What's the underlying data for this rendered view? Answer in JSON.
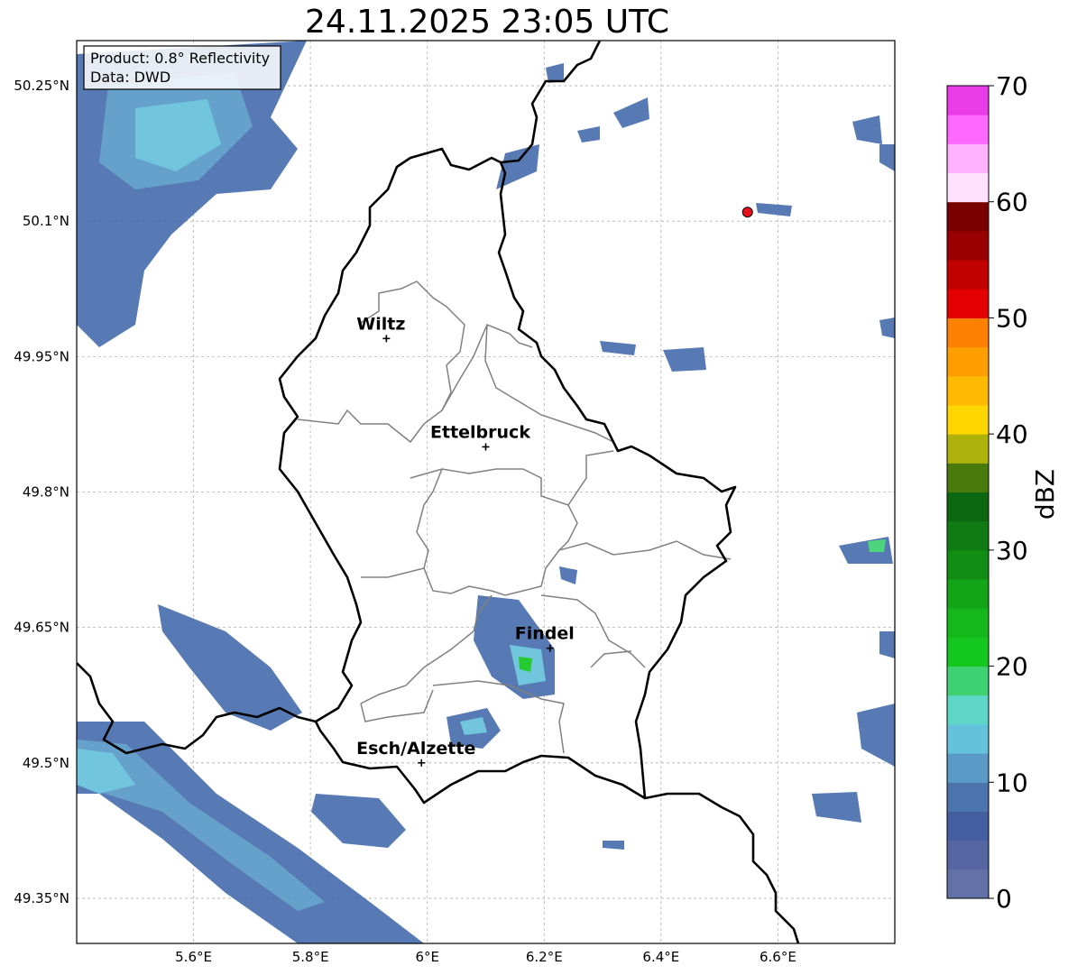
{
  "title": "24.11.2025 23:05 UTC",
  "info_box": {
    "product": "Product: 0.8° Reflectivity",
    "data_source": "Data: DWD"
  },
  "map": {
    "lon_range": [
      5.4,
      6.8
    ],
    "lat_range": [
      49.3,
      50.3
    ],
    "x_ticks": [
      {
        "value": 5.6,
        "label": "5.6°E"
      },
      {
        "value": 5.8,
        "label": "5.8°E"
      },
      {
        "value": 6.0,
        "label": "6°E"
      },
      {
        "value": 6.2,
        "label": "6.2°E"
      },
      {
        "value": 6.4,
        "label": "6.4°E"
      },
      {
        "value": 6.6,
        "label": "6.6°E"
      }
    ],
    "y_ticks": [
      {
        "value": 50.25,
        "label": "50.25°N"
      },
      {
        "value": 50.1,
        "label": "50.1°N"
      },
      {
        "value": 49.95,
        "label": "49.95°N"
      },
      {
        "value": 49.8,
        "label": "49.8°N"
      },
      {
        "value": 49.65,
        "label": "49.65°N"
      },
      {
        "value": 49.5,
        "label": "49.5°N"
      },
      {
        "value": 49.35,
        "label": "49.35°N"
      }
    ],
    "grid": true,
    "cities": [
      {
        "name": "Wiltz",
        "lon": 5.93,
        "lat": 49.97
      },
      {
        "name": "Ettelbruck",
        "lon": 6.1,
        "lat": 49.85
      },
      {
        "name": "Findel",
        "lon": 6.21,
        "lat": 49.627
      },
      {
        "name": "Esch/Alzette",
        "lon": 5.99,
        "lat": 49.5
      }
    ],
    "radar_site": {
      "lon": 6.548,
      "lat": 50.11,
      "color": "#e8101a"
    }
  },
  "colorbar": {
    "label": "dBZ",
    "ticks": [
      "0",
      "10",
      "20",
      "30",
      "40",
      "50",
      "60",
      "70"
    ],
    "colors": [
      "#6272a8",
      "#5566a2",
      "#455ea0",
      "#4b74ad",
      "#5a9ac7",
      "#65c2dc",
      "#5ed6c8",
      "#3ed273",
      "#14c71e",
      "#14b81a",
      "#12a517",
      "#118d13",
      "#0f7b12",
      "#0b6710",
      "#4a7a0c",
      "#aeb20b",
      "#ffd600",
      "#ffba00",
      "#ff9e00",
      "#ff8000",
      "#e40000",
      "#c10000",
      "#9a0000",
      "#7a0000",
      "#ffe0ff",
      "#ffb2ff",
      "#ff68ff",
      "#e93be8"
    ]
  }
}
